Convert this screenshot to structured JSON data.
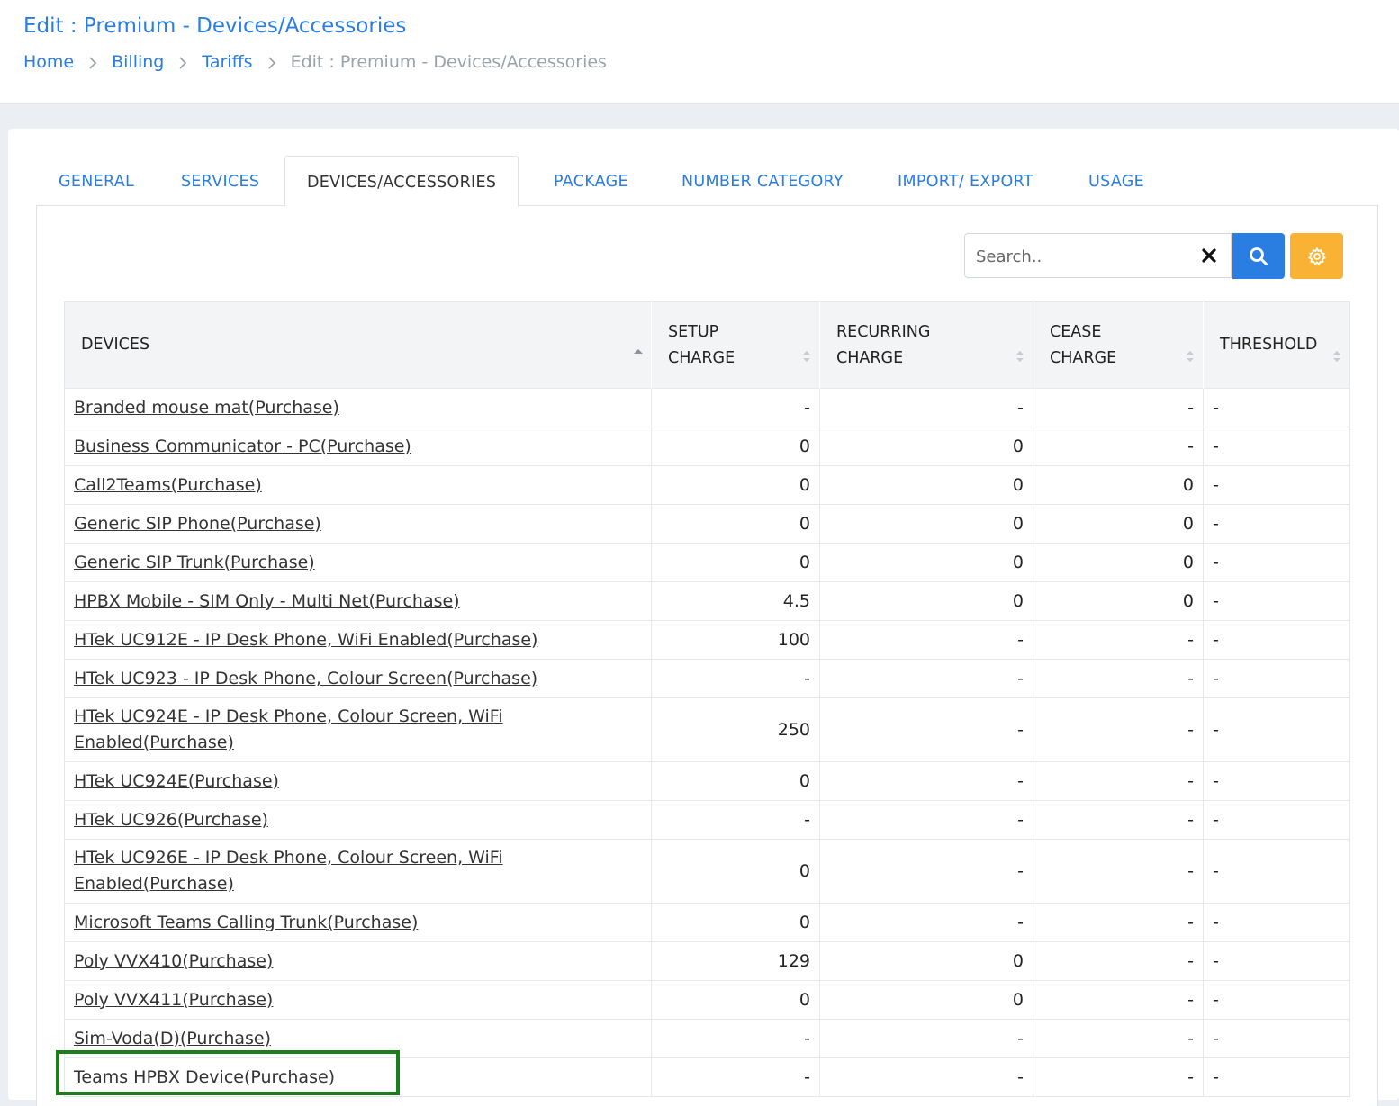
{
  "header": {
    "title": "Edit : Premium - Devices/Accessories",
    "breadcrumb": [
      "Home",
      "Billing",
      "Tariffs"
    ],
    "breadcrumb_current": "Edit : Premium - Devices/Accessories"
  },
  "tabs": [
    "GENERAL",
    "SERVICES",
    "DEVICES/ACCESSORIES",
    "PACKAGE",
    "NUMBER CATEGORY",
    "IMPORT/ EXPORT",
    "USAGE"
  ],
  "active_tab": "DEVICES/ACCESSORIES",
  "search": {
    "placeholder": "Search..",
    "value": ""
  },
  "colors": {
    "accent": "#2a7de1",
    "settings": "#f9b233",
    "highlight": "#1a7e1a"
  },
  "table": {
    "headers": {
      "devices": "DEVICES",
      "setup": [
        "SETUP",
        "CHARGE"
      ],
      "recurring": [
        "RECURRING",
        "CHARGE"
      ],
      "cease": [
        "CEASE",
        "CHARGE"
      ],
      "threshold": "THRESHOLD"
    },
    "rows": [
      {
        "device": "Branded mouse mat(Purchase)",
        "setup": "-",
        "recurring": "-",
        "cease": "-",
        "threshold": "-"
      },
      {
        "device": "Business Communicator - PC(Purchase)",
        "setup": "0",
        "recurring": "0",
        "cease": "-",
        "threshold": "-"
      },
      {
        "device": "Call2Teams(Purchase)",
        "setup": "0",
        "recurring": "0",
        "cease": "0",
        "threshold": "-"
      },
      {
        "device": "Generic SIP Phone(Purchase)",
        "setup": "0",
        "recurring": "0",
        "cease": "0",
        "threshold": "-"
      },
      {
        "device": "Generic SIP Trunk(Purchase)",
        "setup": "0",
        "recurring": "0",
        "cease": "0",
        "threshold": "-"
      },
      {
        "device": "HPBX Mobile - SIM Only - Multi Net(Purchase)",
        "setup": "4.5",
        "recurring": "0",
        "cease": "0",
        "threshold": "-"
      },
      {
        "device": "HTek UC912E - IP Desk Phone, WiFi Enabled(Purchase)",
        "setup": "100",
        "recurring": "-",
        "cease": "-",
        "threshold": "-"
      },
      {
        "device": "HTek UC923 - IP Desk Phone, Colour Screen(Purchase)",
        "setup": "-",
        "recurring": "-",
        "cease": "-",
        "threshold": "-"
      },
      {
        "device": "HTek UC924E - IP Desk Phone, Colour Screen, WiFi Enabled(Purchase)",
        "setup": "250",
        "recurring": "-",
        "cease": "-",
        "threshold": "-"
      },
      {
        "device": "HTek UC924E(Purchase)",
        "setup": "0",
        "recurring": "-",
        "cease": "-",
        "threshold": "-"
      },
      {
        "device": "HTek UC926(Purchase)",
        "setup": "-",
        "recurring": "-",
        "cease": "-",
        "threshold": "-"
      },
      {
        "device": "HTek UC926E - IP Desk Phone, Colour Screen, WiFi Enabled(Purchase)",
        "setup": "0",
        "recurring": "-",
        "cease": "-",
        "threshold": "-"
      },
      {
        "device": "Microsoft Teams Calling Trunk(Purchase)",
        "setup": "0",
        "recurring": "-",
        "cease": "-",
        "threshold": "-"
      },
      {
        "device": "Poly VVX410(Purchase)",
        "setup": "129",
        "recurring": "0",
        "cease": "-",
        "threshold": "-"
      },
      {
        "device": "Poly VVX411(Purchase)",
        "setup": "0",
        "recurring": "0",
        "cease": "-",
        "threshold": "-"
      },
      {
        "device": "Sim-Voda(D)(Purchase)",
        "setup": "-",
        "recurring": "-",
        "cease": "-",
        "threshold": "-"
      },
      {
        "device": "Teams HPBX Device(Purchase)",
        "setup": "-",
        "recurring": "-",
        "cease": "-",
        "threshold": "-"
      }
    ]
  }
}
